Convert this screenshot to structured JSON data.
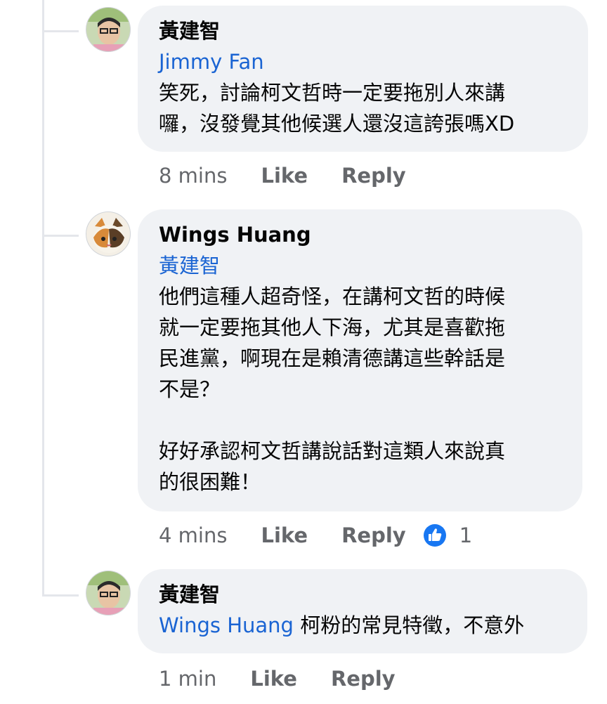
{
  "comments": [
    {
      "author": "黃建智",
      "mention": "Jimmy  Fan",
      "text": "笑死，討論柯文哲時一定要拖別人來講\n囉，沒發覺其他候選人還沒這誇張嗎XD",
      "time": "8 mins",
      "like_label": "Like",
      "reply_label": "Reply"
    },
    {
      "author": "Wings Huang",
      "mention": "黃建智",
      "text": "他們這種人超奇怪，在講柯文哲的時候\n就一定要拖其他人下海，尤其是喜歡拖\n民進黨，啊現在是賴清德講這些幹話是\n不是？\n\n好好承認柯文哲講說話對這類人來說真\n的很困難！",
      "time": "4 mins",
      "like_label": "Like",
      "reply_label": "Reply",
      "reaction_count": "1",
      "reaction_icon": "like-thumb-icon",
      "reaction_color": "#1877f2"
    },
    {
      "author": "黃建智",
      "mention": "Wings Huang",
      "text": "柯粉的常見特徵，不意外",
      "time": "1 min",
      "like_label": "Like",
      "reply_label": "Reply"
    }
  ],
  "colors": {
    "bubble": "#f0f2f5",
    "mention": "#1a64d3",
    "meta": "#65676b",
    "thread_line": "#e4e6eb"
  }
}
